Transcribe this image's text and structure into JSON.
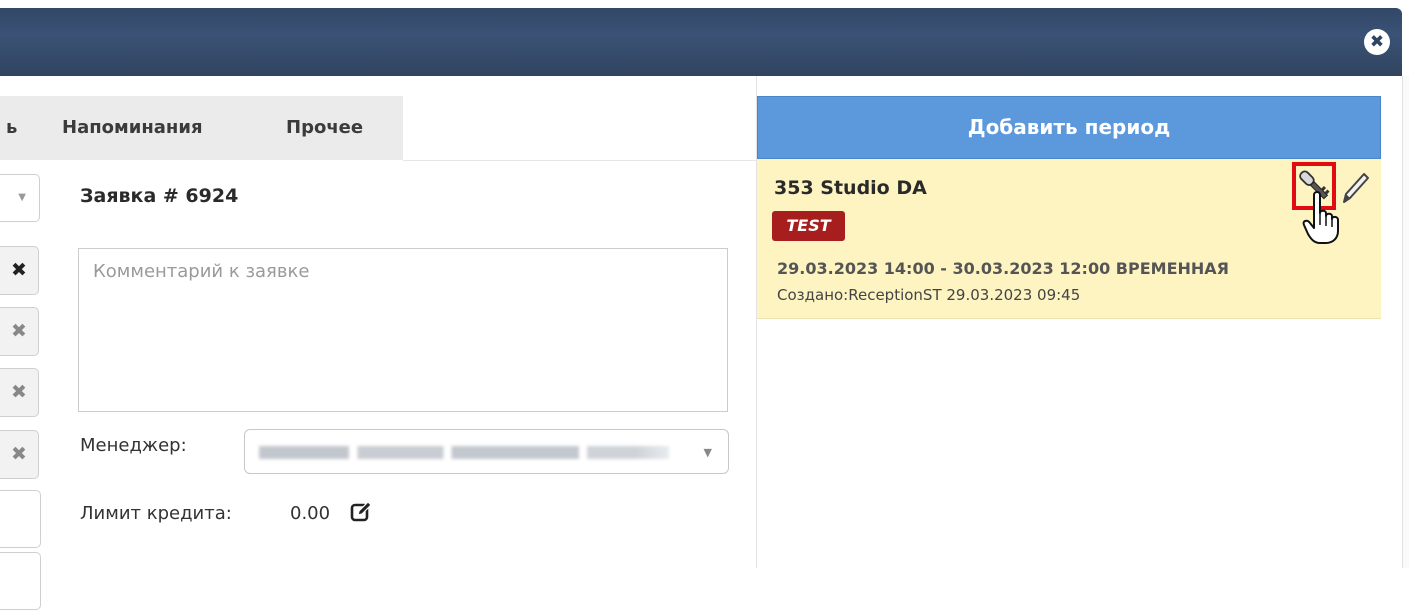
{
  "window": {
    "close_icon": "close-circle-icon"
  },
  "tabs": [
    {
      "label": "ь"
    },
    {
      "label": "Напоминания"
    },
    {
      "label": "Прочее"
    }
  ],
  "request": {
    "title": "Заявка # 6924",
    "comment_placeholder": "Комментарий к заявке",
    "manager_label": "Менеджер:",
    "credit_label": "Лимит кредита:",
    "credit_value": "0.00"
  },
  "periods": {
    "add_button": "Добавить период",
    "items": [
      {
        "name": "353 Studio DA",
        "badge": "TEST",
        "dates": "29.03.2023 14:00 - 30.03.2023 12:00 ВРЕМЕННАЯ",
        "created": "Создано:ReceptionST 29.03.2023 09:45",
        "badge_color": "#a61e1e",
        "highlight_color": "#e10c12"
      }
    ]
  }
}
